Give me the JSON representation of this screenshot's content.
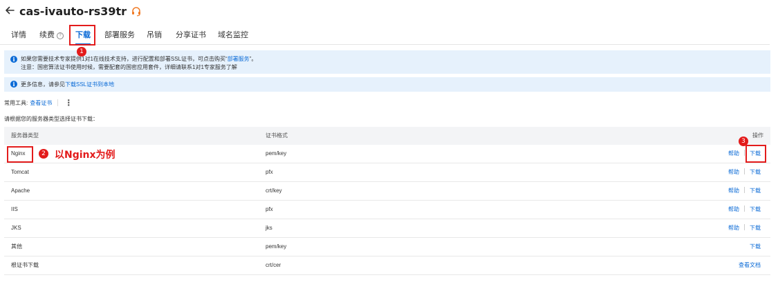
{
  "header": {
    "back_icon": "arrow-left-icon",
    "title": "cas-ivauto-rs39tr",
    "support_icon": "headset-icon",
    "support_color": "#f07a24"
  },
  "tabs": [
    {
      "label": "详情"
    },
    {
      "label": "续费"
    },
    {
      "label": "下载",
      "active": true
    },
    {
      "label": "部署服务"
    },
    {
      "label": "吊销"
    },
    {
      "label": "分享证书"
    },
    {
      "label": "域名监控"
    }
  ],
  "renew_help_icon": "question-circle-icon",
  "notice1": {
    "line1_prefix": "如果您需要技术专家提供1对1在线技术支持，进行配置和部署SSL证书，可点击购买“",
    "line1_link": "部署服务",
    "line1_suffix": "”。",
    "line2": "注意：国密算法证书使用时候，需要配套的国密应用套件，详细请联系1对1专家服务了解"
  },
  "notice2": {
    "prefix": "更多信息，请参见",
    "link": "下载SSL证书到本地"
  },
  "tools": {
    "label": "常用工具:",
    "link": "查看证书",
    "more_icon": "more-vertical-icon"
  },
  "hint": "请根据您的服务器类型选择证书下载：",
  "table": {
    "headers": {
      "server": "服务器类型",
      "format": "证书格式",
      "action": "操作"
    },
    "rows": [
      {
        "server": "Nginx",
        "format": "pem/key",
        "help": "帮助",
        "download": "下载"
      },
      {
        "server": "Tomcat",
        "format": "pfx",
        "help": "帮助",
        "download": "下载"
      },
      {
        "server": "Apache",
        "format": "crt/key",
        "help": "帮助",
        "download": "下载"
      },
      {
        "server": "IIS",
        "format": "pfx",
        "help": "帮助",
        "download": "下载"
      },
      {
        "server": "JKS",
        "format": "jks",
        "help": "帮助",
        "download": "下载"
      },
      {
        "server": "其他",
        "format": "pem/key",
        "download": "下载"
      },
      {
        "server": "根证书下载",
        "format": "crt/cer",
        "docs": "查看文档"
      }
    ]
  },
  "annotations": {
    "step1": "1",
    "step2": "2",
    "step3": "3",
    "text": "以Nginx为例",
    "color": "#e31b1b"
  },
  "colors": {
    "accent": "#0a6ad6",
    "notice_bg": "#e6f1fc",
    "table_head_bg": "#f3f4f6"
  }
}
